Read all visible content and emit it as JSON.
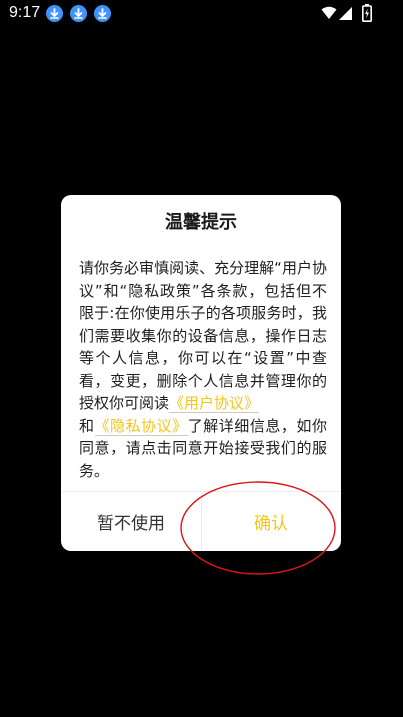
{
  "status_bar": {
    "time": "9:17",
    "icons": [
      "download-icon",
      "download-icon",
      "download-icon",
      "wifi-icon",
      "signal-icon",
      "battery-charging-icon"
    ],
    "download_color": "#3f93ff"
  },
  "dialog": {
    "title": "温馨提示",
    "body_part1": "请你务必审慎阅读、充分理解“用户协议”和“隐私政策”各条款，包括但不限于:在你使用乐子的各项服务时，我们需要收集你的设备信息，操作日志等个人信息，你可以在“设置”中查看，变更，删除个人信息并管理你的授权你可阅读",
    "link_user_agreement": "《用户协议》",
    "body_and": "和",
    "link_privacy": "《隐私协议》",
    "body_part2": "了解详细信息，如你同意，请点击同意开始接受我们的服务。",
    "cancel_label": "暂不使用",
    "confirm_label": "确认",
    "accent_color": "#f5c518",
    "annotation_color": "#d9161c"
  }
}
